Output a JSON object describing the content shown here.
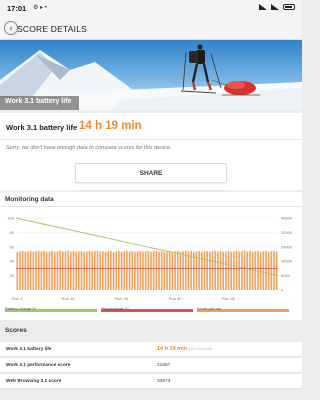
{
  "status_bar": {
    "time": "17:01",
    "notifications": "⚙ ▸ •"
  },
  "header": {
    "title": "SCORE DETAILS"
  },
  "hero": {
    "label": "Work 3.1 battery life"
  },
  "result": {
    "label": "Work 3.1 battery life",
    "value": "14 h 19 min",
    "note": "Sorry, we don't have enough data to compare scores for this device."
  },
  "share": {
    "label": "SHARE"
  },
  "monitoring": {
    "title": "Monitoring data",
    "y_left_ticks": [
      "100",
      "80",
      "60",
      "40",
      "20"
    ],
    "y_right_ticks": [
      "40000",
      "32000",
      "24000",
      "16000",
      "8000",
      "0"
    ],
    "x_ticks": [
      "Run 1",
      "Run 20",
      "Run 40",
      "Run 60",
      "Run 80"
    ],
    "legend": [
      "Battery charge %",
      "Temperature °C",
      "Score per run"
    ]
  },
  "chart_data": {
    "type": "bar",
    "runs": 98,
    "series": [
      {
        "name": "Score per run",
        "color": "#f5a05a",
        "approx_value": 21500,
        "axis": "right"
      },
      {
        "name": "Battery charge %",
        "color": "#9ccc65",
        "start": 100,
        "end": 20,
        "axis": "left"
      },
      {
        "name": "Temperature °C",
        "color": "#d9534f",
        "approx_value": 30,
        "axis": "left"
      }
    ],
    "y_left_range": [
      0,
      100
    ],
    "y_right_range": [
      0,
      40000
    ]
  },
  "scores": {
    "title": "Scores",
    "rows": [
      {
        "name": "Work 3.1 battery life",
        "value": "14 h 19 min",
        "sub": "(14 h 19 min)"
      },
      {
        "name": "Work 3.1 performance score",
        "value": "21667",
        "sub": ""
      },
      {
        "name": "Web Browsing 3.1 score",
        "value": "33973",
        "sub": ""
      }
    ]
  }
}
